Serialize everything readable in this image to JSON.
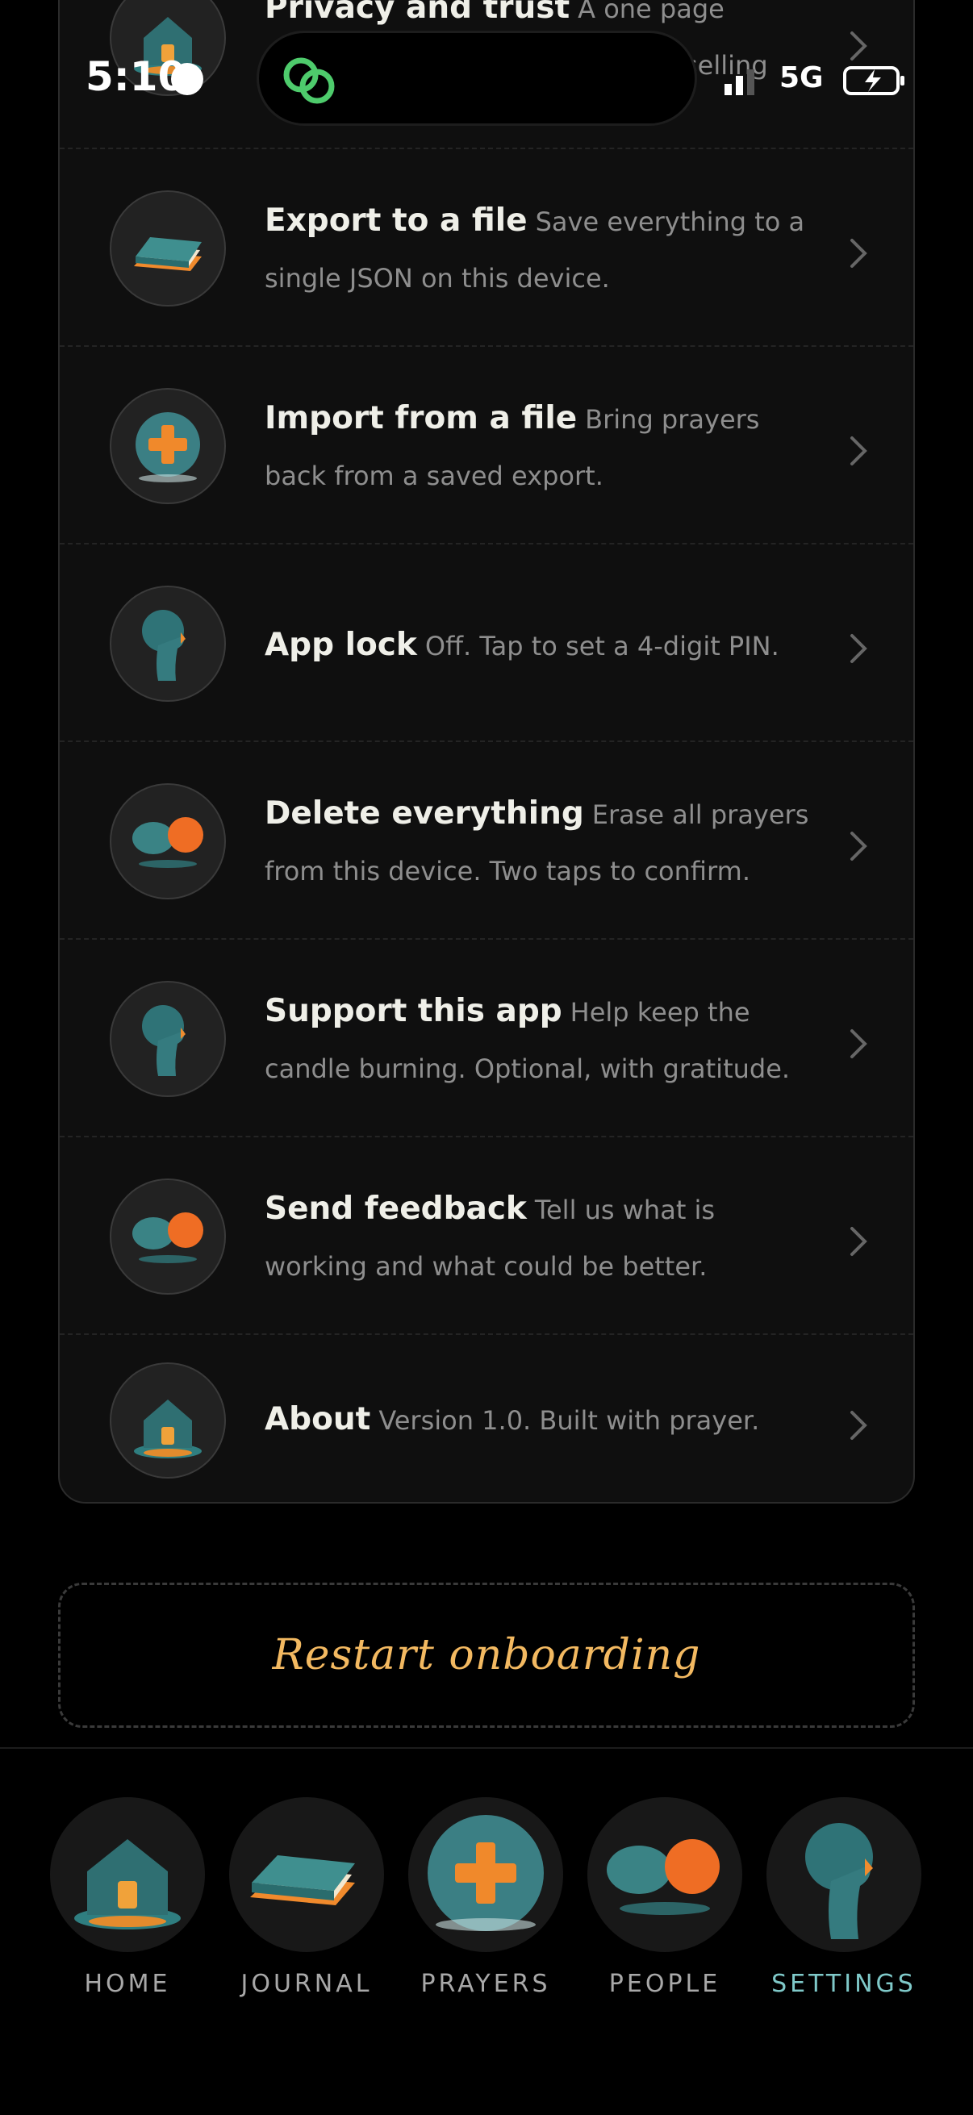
{
  "status_bar": {
    "time": "5:10",
    "network": "5G"
  },
  "settings_rows": [
    {
      "title": "Privacy and trust",
      "desc": "A one page",
      "extra": "selling",
      "icon": "house-lamp-icon"
    },
    {
      "title": "Export to a file",
      "desc": "Save everything to a single JSON on this device.",
      "icon": "book-icon"
    },
    {
      "title": "Import from a file",
      "desc": "Bring prayers back from a saved export.",
      "icon": "cross-orb-icon"
    },
    {
      "title": "App lock",
      "desc": "Off. Tap to set a 4-digit PIN.",
      "icon": "profile-head-icon"
    },
    {
      "title": "Delete everything",
      "desc": "Erase all prayers from this device. Two taps to confirm.",
      "icon": "speech-bubbles-icon"
    },
    {
      "title": "Support this app",
      "desc": "Help keep the candle burning. Optional, with gratitude.",
      "icon": "profile-head-icon"
    },
    {
      "title": "Send feedback",
      "desc": "Tell us what is working and what could be better.",
      "icon": "speech-bubbles-icon"
    },
    {
      "title": "About",
      "desc": "Version 1.0. Built with prayer.",
      "icon": "house-lamp-icon"
    }
  ],
  "restart_label": "Restart onboarding",
  "nav": [
    {
      "label": "HOME",
      "icon": "house-lamp-icon"
    },
    {
      "label": "JOURNAL",
      "icon": "book-icon"
    },
    {
      "label": "PRAYERS",
      "icon": "cross-orb-icon"
    },
    {
      "label": "PEOPLE",
      "icon": "speech-bubbles-icon"
    },
    {
      "label": "SETTINGS",
      "icon": "profile-head-icon",
      "active": true
    }
  ],
  "colors": {
    "accent": "#f3b961",
    "active_tab": "#7fc9c9",
    "teal": "#3f8c8e",
    "orange": "#f07c2c"
  }
}
